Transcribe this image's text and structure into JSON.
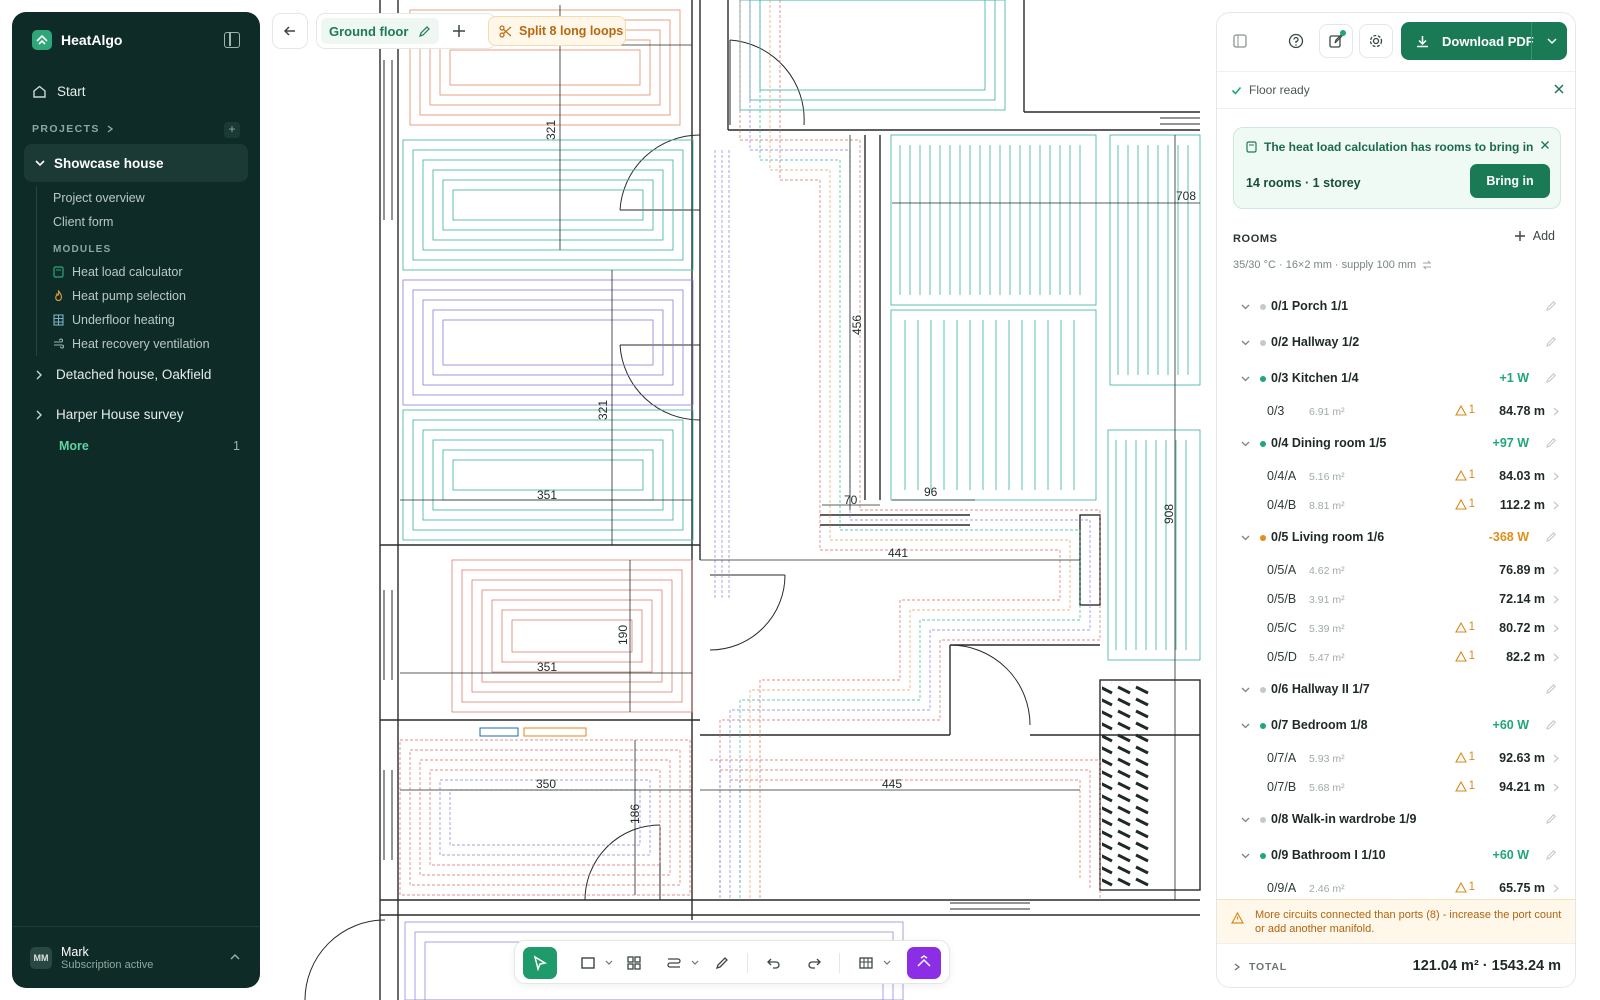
{
  "app": {
    "name": "HeatAlgo"
  },
  "sidebar": {
    "start": "Start",
    "projects_heading": "PROJECTS",
    "active_project": "Showcase house",
    "subitems": [
      "Project overview",
      "Client form"
    ],
    "modules_heading": "MODULES",
    "modules": [
      {
        "label": "Heat load calculator",
        "icon": "calculator-icon"
      },
      {
        "label": "Heat pump selection",
        "icon": "flame-icon"
      },
      {
        "label": "Underfloor heating",
        "icon": "grid-icon"
      },
      {
        "label": "Heat recovery ventilation",
        "icon": "wind-icon"
      }
    ],
    "projects": [
      "Detached house, Oakfield",
      "Harper House survey"
    ],
    "more_label": "More",
    "more_count": "1",
    "user": {
      "initials": "MM",
      "name": "Mark",
      "status": "Subscription active"
    }
  },
  "toolbar": {
    "floor": "Ground floor",
    "split": "Split 8 long loops"
  },
  "plan": {
    "dims": [
      "321",
      "321",
      "351",
      "351",
      "190",
      "350",
      "186",
      "456",
      "70",
      "96",
      "441",
      "445",
      "708",
      "908"
    ]
  },
  "panel": {
    "download": "Download PDF",
    "status": "Floor ready",
    "notice_title": "The heat load calculation has rooms to bring in",
    "notice_summary": "14 rooms · 1 storey",
    "bring_in": "Bring in",
    "rooms_heading": "ROOMS",
    "add": "Add",
    "rooms_sub": "35/30 °C · 16×2 mm · supply 100 mm",
    "rows": [
      {
        "kind": "room",
        "name": "0/1 Porch 1/1",
        "w": "",
        "status": "grey"
      },
      {
        "kind": "room",
        "name": "0/2 Hallway 1/2",
        "w": "",
        "status": "grey"
      },
      {
        "kind": "room",
        "name": "0/3 Kitchen 1/4",
        "w": "+1 W",
        "status": "green"
      },
      {
        "kind": "circuit",
        "name": "0/3",
        "area": "6.91 m²",
        "warn": "1",
        "len": "84.78 m"
      },
      {
        "kind": "room",
        "name": "0/4 Dining room 1/5",
        "w": "+97 W",
        "status": "green"
      },
      {
        "kind": "circuit",
        "name": "0/4/A",
        "area": "5.16 m²",
        "warn": "1",
        "len": "84.03 m"
      },
      {
        "kind": "circuit",
        "name": "0/4/B",
        "area": "8.81 m²",
        "warn": "1",
        "len": "112.2 m"
      },
      {
        "kind": "room",
        "name": "0/5 Living room 1/6",
        "w": "-368 W",
        "status": "orange"
      },
      {
        "kind": "circuit",
        "name": "0/5/A",
        "area": "4.62 m²",
        "warn": "",
        "len": "76.89 m"
      },
      {
        "kind": "circuit",
        "name": "0/5/B",
        "area": "3.91 m²",
        "warn": "",
        "len": "72.14 m"
      },
      {
        "kind": "circuit",
        "name": "0/5/C",
        "area": "5.39 m²",
        "warn": "1",
        "len": "80.72 m"
      },
      {
        "kind": "circuit",
        "name": "0/5/D",
        "area": "5.47 m²",
        "warn": "1",
        "len": "82.2 m"
      },
      {
        "kind": "room",
        "name": "0/6 Hallway II 1/7",
        "w": "",
        "status": "grey"
      },
      {
        "kind": "room",
        "name": "0/7 Bedroom 1/8",
        "w": "+60 W",
        "status": "green"
      },
      {
        "kind": "circuit",
        "name": "0/7/A",
        "area": "5.93 m²",
        "warn": "1",
        "len": "92.63 m"
      },
      {
        "kind": "circuit",
        "name": "0/7/B",
        "area": "5.68 m²",
        "warn": "1",
        "len": "94.21 m"
      },
      {
        "kind": "room",
        "name": "0/8 Walk-in wardrobe 1/9",
        "w": "",
        "status": "grey"
      },
      {
        "kind": "room",
        "name": "0/9 Bathroom I 1/10",
        "w": "+60 W",
        "status": "green"
      },
      {
        "kind": "circuit",
        "name": "0/9/A",
        "area": "2.46 m²",
        "warn": "1",
        "len": "65.75 m"
      }
    ],
    "warning": "More circuits connected than ports (8) - increase the port count or add another manifold.",
    "total_label": "TOTAL",
    "total_value": "121.04 m² · 1543.24 m"
  },
  "colors": {
    "brand": "#1b7a56",
    "sidebar": "#0f2b27",
    "ok": "#1fa67a",
    "warn": "#d98a1a",
    "ai": "#8b2ee6"
  }
}
